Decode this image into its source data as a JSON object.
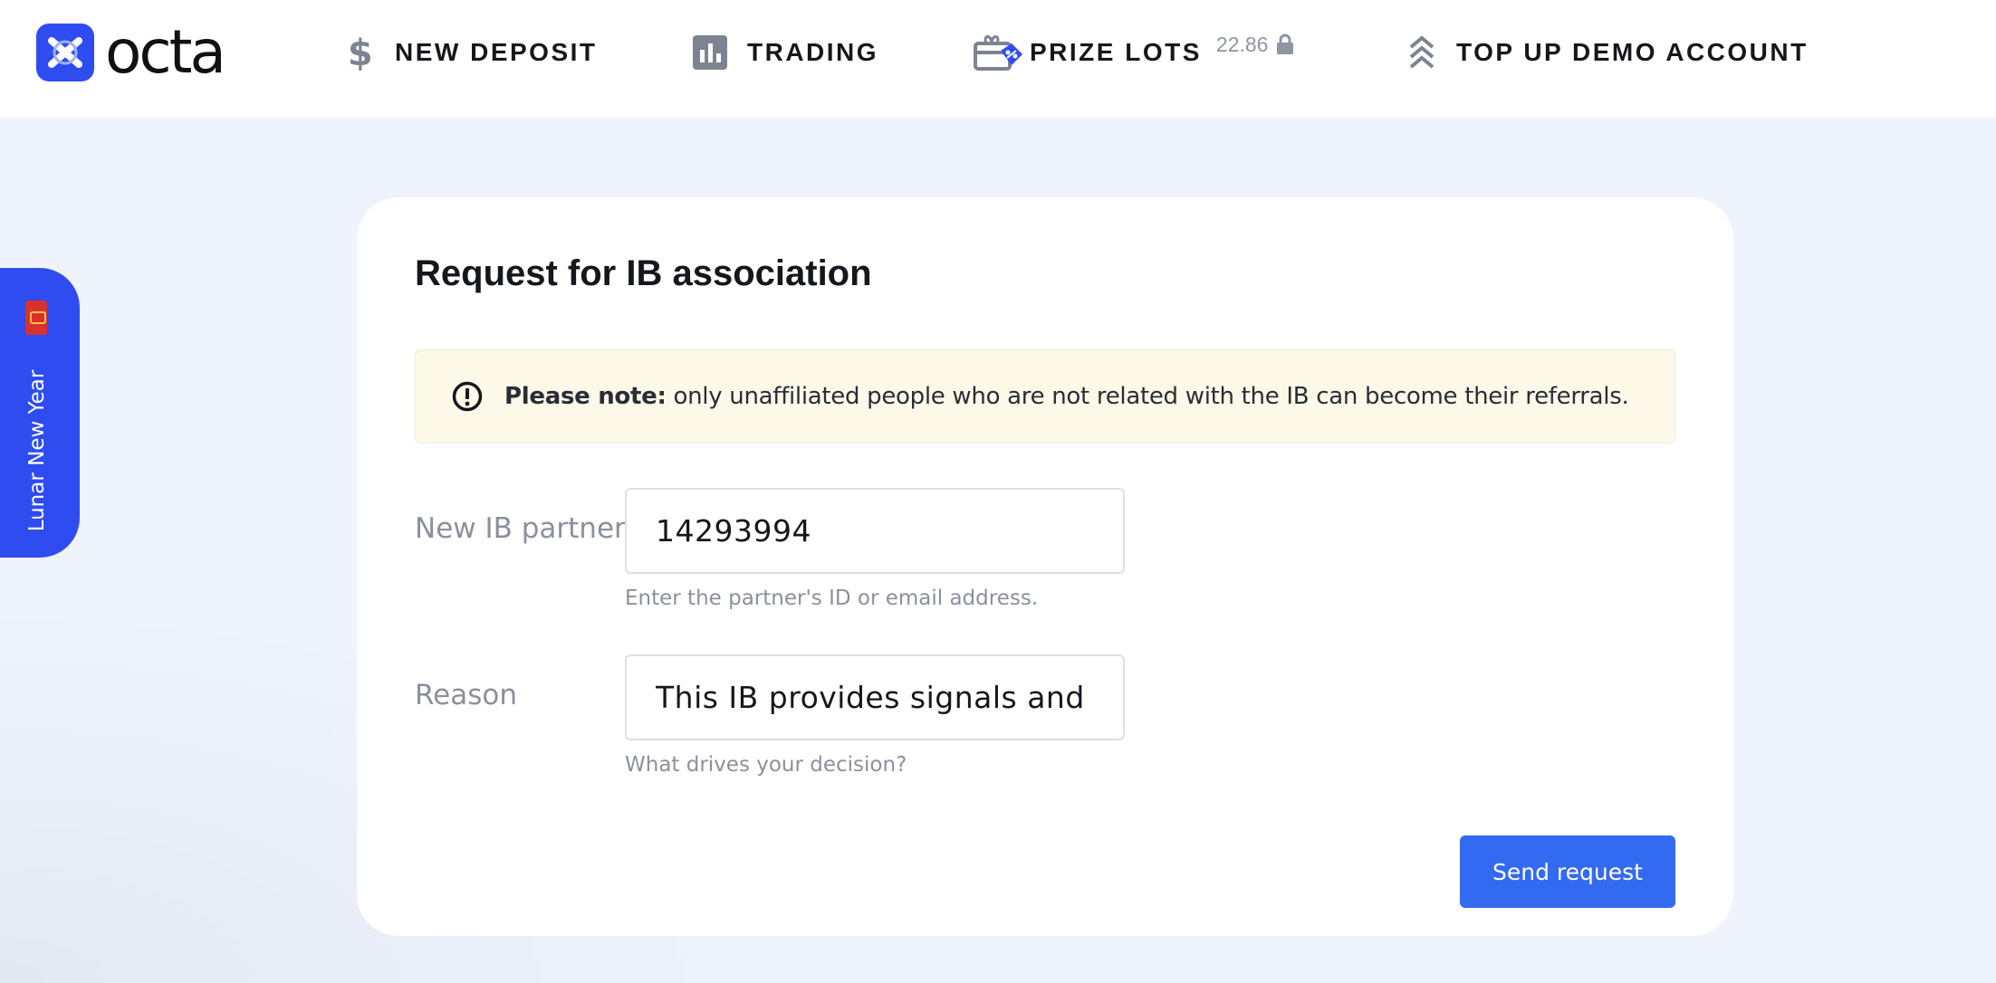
{
  "header": {
    "logo_text": "octa",
    "nav": {
      "deposit": {
        "label": "NEW DEPOSIT",
        "icon": "dollar-icon"
      },
      "trading": {
        "label": "TRADING",
        "icon": "bar-chart-icon"
      },
      "prize": {
        "label": "PRIZE LOTS",
        "icon": "gift-card-icon",
        "value": "22.86",
        "lock_icon": "lock-icon"
      },
      "topup": {
        "label": "TOP UP DEMO ACCOUNT",
        "icon": "double-chevron-up-icon"
      }
    }
  },
  "side_tab": {
    "label": "Lunar New Year",
    "icon": "red-envelope-icon"
  },
  "form": {
    "title": "Request for IB association",
    "notice": {
      "bold": "Please note:",
      "text": " only unaffiliated people who are not related with the IB can become their referrals.",
      "icon": "exclamation-circle-icon"
    },
    "partner": {
      "label": "New IB partner",
      "value": "14293994",
      "hint": "Enter the partner's ID or email address."
    },
    "reason": {
      "label": "Reason",
      "value": "This IB provides signals and edu",
      "hint": "What drives your decision?"
    },
    "submit_label": "Send request"
  },
  "colors": {
    "accent": "#2f4cf0",
    "button": "#336af2",
    "notice_bg": "#fcf9e8",
    "page_bg": "#eff3fb"
  }
}
